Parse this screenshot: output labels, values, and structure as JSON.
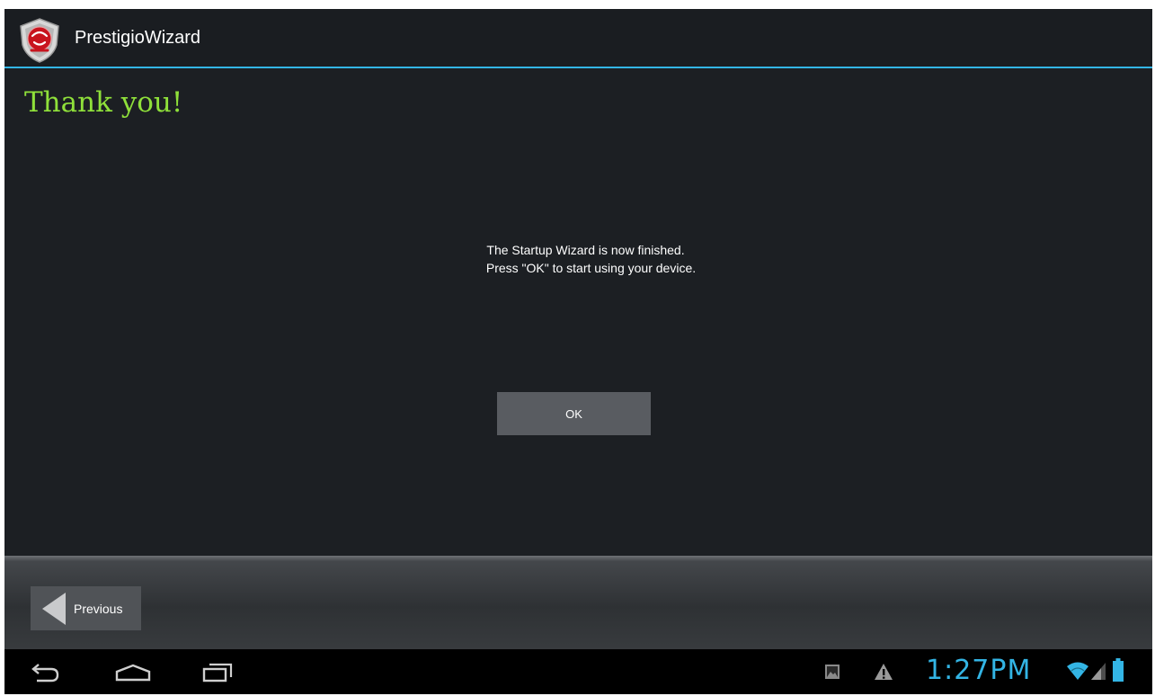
{
  "app": {
    "title": "PrestigioWizard"
  },
  "content": {
    "heading": "Thank you!",
    "message_line1": "The Startup Wizard is now finished.",
    "message_line2": "Press \"OK\" to start using your device.",
    "ok_label": "OK"
  },
  "footer": {
    "previous_label": "Previous"
  },
  "status": {
    "time": "1:27PM"
  },
  "colors": {
    "accent": "#33b5e5",
    "heading": "#8fe03a",
    "background": "#1c1f23"
  }
}
